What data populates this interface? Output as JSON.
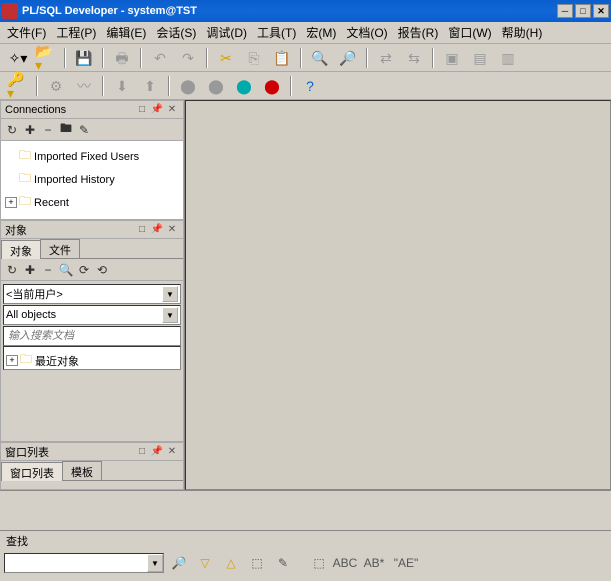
{
  "title": "PL/SQL Developer - system@TST",
  "menu": [
    "文件(F)",
    "工程(P)",
    "编辑(E)",
    "会话(S)",
    "调试(D)",
    "工具(T)",
    "宏(M)",
    "文档(O)",
    "报告(R)",
    "窗口(W)",
    "帮助(H)"
  ],
  "panels": {
    "connections": {
      "title": "Connections",
      "items": [
        "Imported Fixed Users",
        "Imported History",
        "Recent"
      ]
    },
    "objects": {
      "title": "对象",
      "tabs": [
        "对象",
        "文件"
      ],
      "user_dropdown": "<当前用户>",
      "filter_dropdown": "All objects",
      "search_placeholder": "输入搜索文档",
      "recent": "最近对象"
    },
    "windowlist": {
      "title": "窗口列表",
      "tabs": [
        "窗口列表",
        "模板"
      ]
    }
  },
  "find": {
    "title": "查找",
    "re_label": "\"AE\""
  }
}
